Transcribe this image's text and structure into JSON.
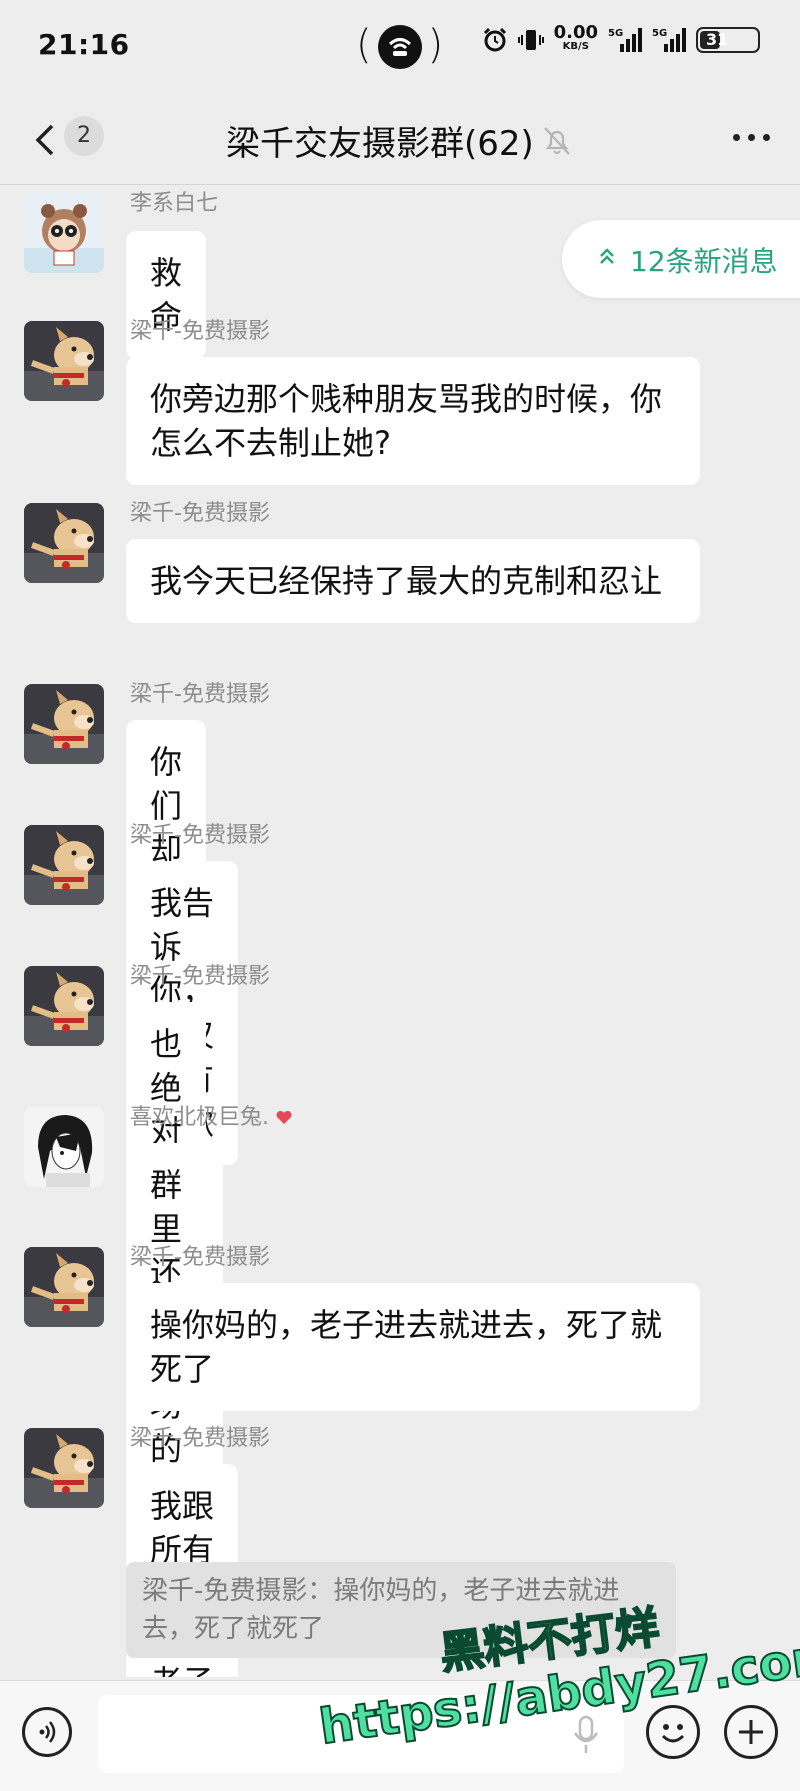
{
  "status_bar": {
    "time": "21:16",
    "hotspot_open": "(",
    "hotspot_close": ")",
    "net_speed": "0.00",
    "net_unit": "KB/S",
    "sim1_label": "5G",
    "sim2_label": "5G",
    "battery": "31"
  },
  "header": {
    "back_count": "2",
    "title": "梁千交友摄影群(62)",
    "muted_icon": "bell-off-icon",
    "more_icon": "more-icon"
  },
  "new_messages": {
    "label": "12条新消息",
    "icon": "double-chevron-up-icon"
  },
  "messages": [
    {
      "sender": "李系白七",
      "text": "救命",
      "avatar": "cartoon-avatar"
    },
    {
      "sender": "梁千-免费摄影",
      "text": "你旁边那个贱种朋友骂我的时候，你怎么不去制止她?",
      "avatar": "dog-avatar"
    },
    {
      "sender": "梁千-免费摄影",
      "text": "我今天已经保持了最大的克制和忍让",
      "avatar": "dog-avatar"
    },
    {
      "sender": "梁千-免费摄影",
      "text": "你们却还要逼着我道歉",
      "avatar": "dog-avatar"
    },
    {
      "sender": "梁千-免费摄影",
      "text": "我告诉你，不仅没有道歉",
      "avatar": "dog-avatar"
    },
    {
      "sender": "梁千-免费摄影",
      "text": "也绝对不会赔偿你一分钱",
      "avatar": "dog-avatar"
    },
    {
      "sender": "喜欢北极巨兔.",
      "text": "群里还有现场的人?",
      "avatar": "anime-avatar"
    },
    {
      "sender": "梁千-免费摄影",
      "text": "操你妈的，老子进去就进去，死了就死了",
      "avatar": "dog-avatar"
    },
    {
      "sender": "梁千-免费摄影",
      "text": "我跟所有人声明，老子不怕",
      "avatar": "dog-avatar"
    }
  ],
  "quote": {
    "text": "梁千-免费摄影：操你妈的，老子进去就进去，死了就死了"
  },
  "input_bar": {
    "voice_icon": "voice-icon",
    "emoji_icon": "emoji-icon",
    "plus_icon": "plus-icon",
    "mic_icon": "mic-icon"
  },
  "watermark": {
    "line1": "黑料不打烊",
    "line2": "https://abdy27.com"
  },
  "colors": {
    "background": "#ededed",
    "bubble": "#ffffff",
    "accent_green": "#2aa57a",
    "watermark_green": "#4fe0a0"
  }
}
